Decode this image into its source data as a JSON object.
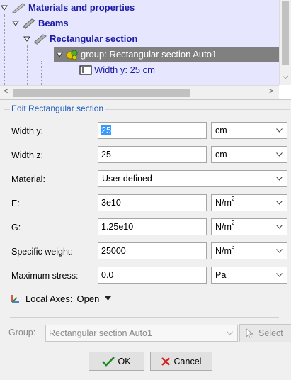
{
  "tree": {
    "items": [
      {
        "label": "Materials and properties",
        "icon": "material-icon"
      },
      {
        "label": "Beams",
        "icon": "beam-icon"
      },
      {
        "label": "Rectangular section",
        "icon": "section-icon"
      },
      {
        "label": "group: Rectangular section Auto1",
        "icon": "group-icon"
      },
      {
        "label": "Width y: 25 cm",
        "icon": "property-icon"
      }
    ]
  },
  "edit": {
    "title": "Edit Rectangular section",
    "rows": [
      {
        "label": "Width y:",
        "value": "25",
        "unit": "cm"
      },
      {
        "label": "Width z:",
        "value": "25",
        "unit": "cm"
      },
      {
        "label": "Material:",
        "value": "User defined"
      },
      {
        "label": "E:",
        "value": "3e10",
        "unit": "N/m",
        "unit_sup": "2"
      },
      {
        "label": "G:",
        "value": "1.25e10",
        "unit": "N/m",
        "unit_sup": "2"
      },
      {
        "label": "Specific weight:",
        "value": "25000",
        "unit": "N/m",
        "unit_sup": "3"
      },
      {
        "label": "Maximum stress:",
        "value": "0.0",
        "unit": "Pa"
      }
    ],
    "local_axes_label": "Local Axes:",
    "local_axes_value": "Open"
  },
  "group_selector": {
    "label": "Group:",
    "value": "Rectangular section Auto1",
    "select_label": "Select"
  },
  "buttons": {
    "ok": "OK",
    "cancel": "Cancel"
  },
  "colors": {
    "tree_bg": "#e6e6ff",
    "tree_text": "#1a1aa6",
    "selected_bg": "#808080",
    "group_title": "#1c5bbf",
    "value_highlight": "#3399ff",
    "ok_check": "#1f8a1f",
    "cancel_x": "#d42020"
  }
}
